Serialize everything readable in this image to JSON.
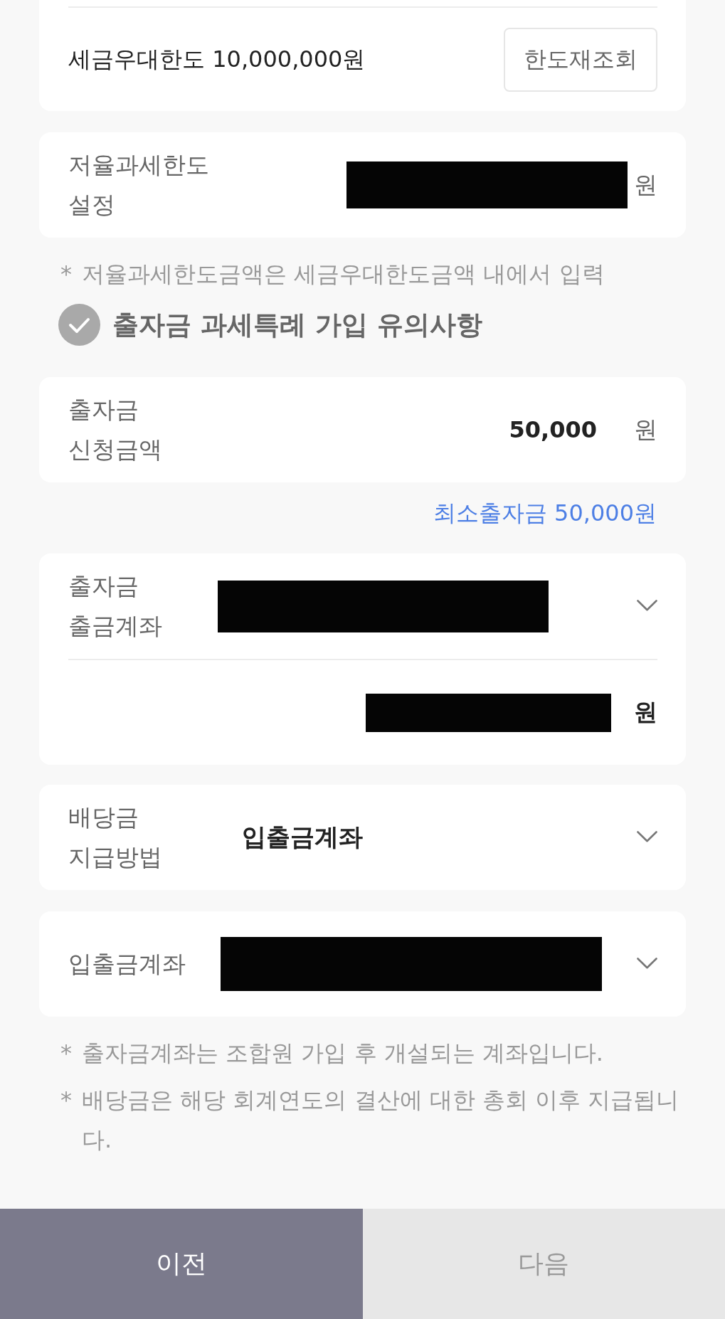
{
  "tax_limit": {
    "text": "세금우대한도 10,000,000원",
    "button": "한도재조회"
  },
  "low_rate_limit": {
    "label": "저율과세한도 설정",
    "redacted": true,
    "unit": "원"
  },
  "notes_top": [
    {
      "marker": "*",
      "text": "저율과세한도금액은 세금우대한도금액 내에서 입력"
    }
  ],
  "agreement": {
    "label": "출자금 과세특례 가입 유의사항",
    "checked": false
  },
  "application_amount": {
    "label": "출자금 신청금액",
    "value": "50,000",
    "unit": "원"
  },
  "minimum_hint": "최소출자금 50,000원",
  "withdrawal_account": {
    "label": "출자금 출금계좌",
    "redacted": true,
    "balance": {
      "redacted": true,
      "unit": "원"
    }
  },
  "dividend_method": {
    "label": "배당금 지급방법",
    "value": "입출금계좌"
  },
  "deposit_account": {
    "label": "입출금계좌",
    "redacted": true
  },
  "notes_bottom": [
    {
      "marker": "*",
      "text": "출자금계좌는 조합원 가입 후 개설되는 계좌입니다."
    },
    {
      "marker": "*",
      "text": "배당금은 해당 회계연도의 결산에 대한 총회 이후 지급됩니다."
    }
  ],
  "previous_button": {
    "label": "이전",
    "disabled": false
  },
  "next_button": {
    "label": "다음",
    "disabled": true
  }
}
